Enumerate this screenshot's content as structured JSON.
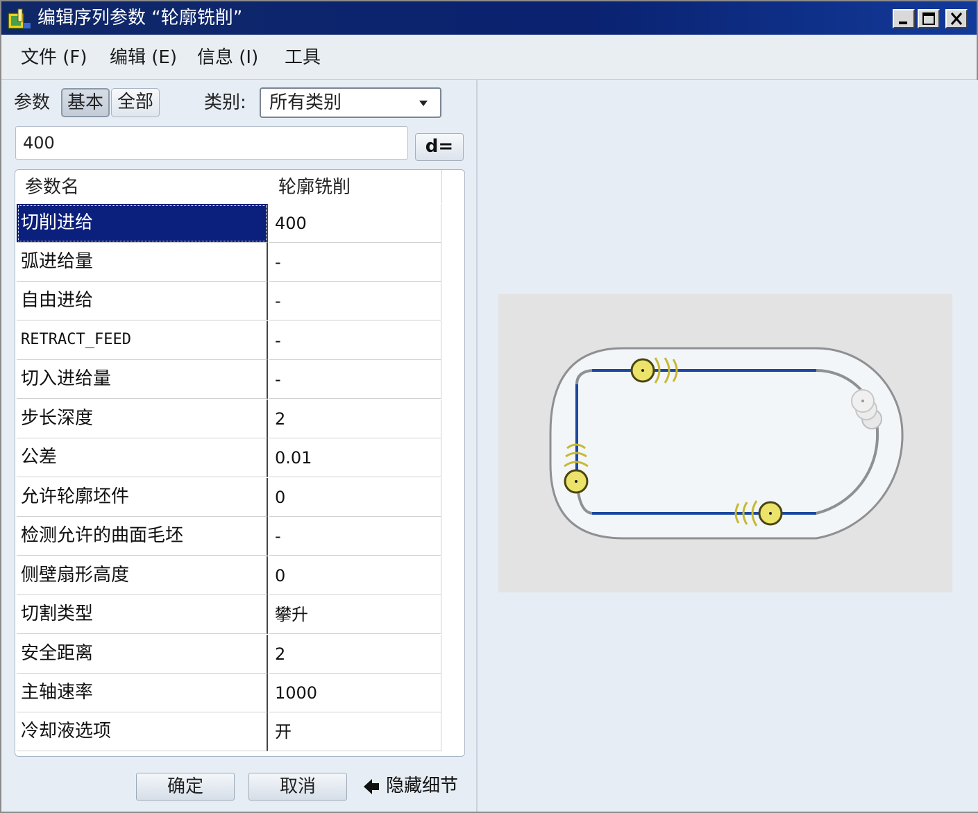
{
  "window": {
    "title": "编辑序列参数 “轮廓铣削”",
    "controls": [
      "minimize",
      "maximize",
      "close"
    ]
  },
  "menu": {
    "items": [
      {
        "label": "文件 (F)"
      },
      {
        "label": "编辑 (E)"
      },
      {
        "label": "信息 (I)"
      },
      {
        "label": "工具"
      }
    ]
  },
  "filter": {
    "params_label": "参数",
    "basic_label": "基本",
    "all_label": "全部",
    "active": "basic",
    "category_label": "类别:",
    "category_value": "所有类别"
  },
  "editor": {
    "value": "400",
    "d_button": "d="
  },
  "table": {
    "headers": [
      "参数名",
      "轮廓铣削"
    ],
    "rows": [
      {
        "name": "切削进给",
        "value": "400",
        "selected": true
      },
      {
        "name": "弧进给量",
        "value": "-"
      },
      {
        "name": "自由进给",
        "value": "-"
      },
      {
        "name": "RETRACT_FEED",
        "value": "-"
      },
      {
        "name": "切入进给量",
        "value": "-"
      },
      {
        "name": "步长深度",
        "value": "2"
      },
      {
        "name": "公差",
        "value": "0.01"
      },
      {
        "name": "允许轮廓坯件",
        "value": "0"
      },
      {
        "name": "检测允许的曲面毛坯",
        "value": "-"
      },
      {
        "name": "侧壁扇形高度",
        "value": "0"
      },
      {
        "name": "切割类型",
        "value": "攀升"
      },
      {
        "name": "安全距离",
        "value": "2"
      },
      {
        "name": "主轴速率",
        "value": "1000"
      },
      {
        "name": "冷却液选项",
        "value": "开"
      }
    ]
  },
  "buttons": {
    "ok": "确定",
    "cancel": "取消",
    "hide_details": "隐藏细节"
  },
  "colors": {
    "titlebar": "#0a2270",
    "selection": "#0b1f7c",
    "toolpath": "#1a48a0",
    "tool_marker": "#e8d84a"
  },
  "icons": {
    "app": "app-icon",
    "dropdown": "chevron-down-icon",
    "hide_details": "arrow-left-icon"
  }
}
